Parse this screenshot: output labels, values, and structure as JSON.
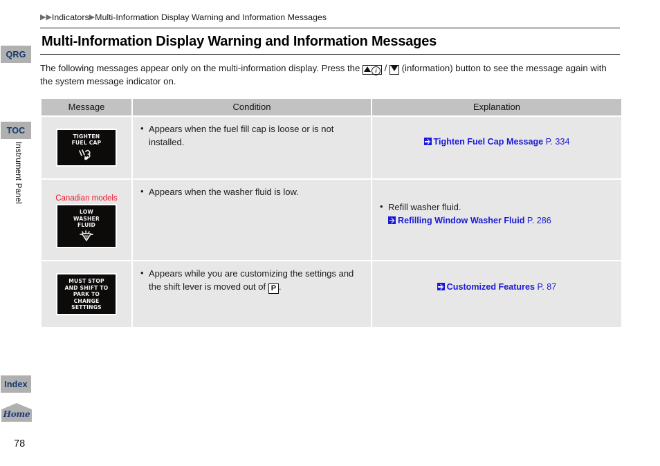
{
  "rail": {
    "tabs": [
      {
        "id": "qrg",
        "label": "QRG"
      },
      {
        "id": "toc",
        "label": "TOC"
      },
      {
        "id": "index",
        "label": "Index"
      }
    ],
    "vertical_label": "Instrument Panel",
    "home_label": "Home",
    "page_number": "78"
  },
  "breadcrumb": {
    "arrow_double": "▶▶",
    "arrow_single": "▶",
    "level1": "Indicators",
    "level2": "Multi-Information Display Warning and Information Messages"
  },
  "page": {
    "title": "Multi-Information Display Warning and Information Messages",
    "intro_part1": "The following messages appear only on the multi-information display. Press the ",
    "intro_separator": " / ",
    "intro_part2": " (information) button to see the message again with the system message indicator on.",
    "info_glyph": "i"
  },
  "table": {
    "headers": [
      "Message",
      "Condition",
      "Explanation"
    ],
    "rows": [
      {
        "message": {
          "note": "",
          "lines": "TIGHTEN\nFUEL CAP",
          "glyph": "fuel-cap-icon"
        },
        "condition": "Appears when the fuel fill cap is loose or is not installed.",
        "explanation": {
          "bullet": "",
          "link_label": "Tighten Fuel Cap Message",
          "link_page": "P. 334"
        }
      },
      {
        "message": {
          "note": "Canadian models",
          "lines": "LOW\nWASHER\nFLUID",
          "glyph": "washer-fluid-icon"
        },
        "condition": "Appears when the washer fluid is low.",
        "explanation": {
          "bullet": "Refill washer fluid.",
          "link_label": "Refilling Window Washer Fluid",
          "link_page": "P. 286"
        }
      },
      {
        "message": {
          "note": "",
          "lines": "MUST STOP\nAND SHIFT TO\nPARK TO\nCHANGE\nSETTINGS",
          "glyph": ""
        },
        "condition_part1": "Appears while you are customizing the settings and the shift lever is moved out of ",
        "condition_shift": "P",
        "condition_part2": ".",
        "explanation": {
          "bullet": "",
          "link_label": "Customized Features",
          "link_page": "P. 87"
        }
      }
    ]
  },
  "colors": {
    "rail_tab_bg": "#b0b0b0",
    "rail_tab_text": "#13386b",
    "table_header_bg": "#c2c2c2",
    "table_cell_bg": "#e7e7e7",
    "link_blue": "#1a1ad6",
    "canadian_red": "#e8192c"
  }
}
